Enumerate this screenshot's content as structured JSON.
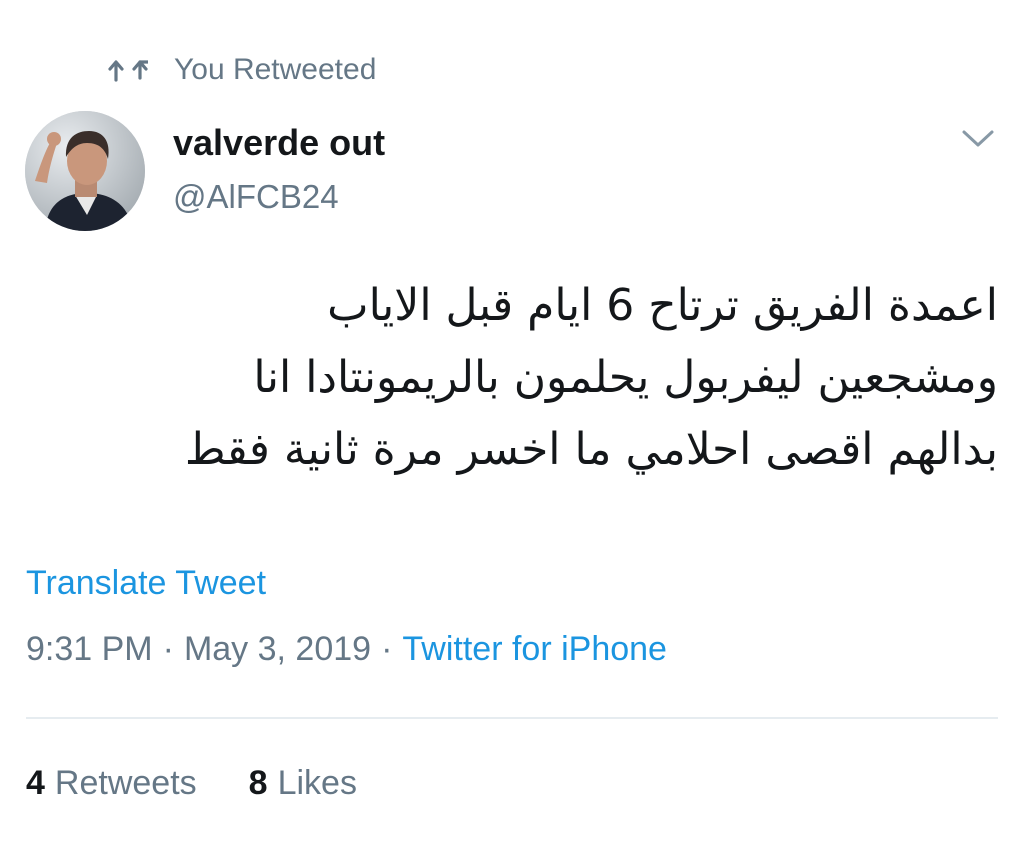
{
  "social_context": {
    "icon": "retweet-icon",
    "label": "You Retweeted"
  },
  "author": {
    "display_name": "valverde out",
    "handle": "@AlFCB24",
    "avatar": "avatar-photo"
  },
  "menu": {
    "icon": "chevron-down-icon"
  },
  "tweet": {
    "text_lines": [
      "اعمدة الفريق ترتاح 6 ايام قبل الاياب",
      "ومشجعين ليفربول يحلمون بالريمونتادا انا",
      "بدالهم اقصى احلامي ما اخسر مرة ثانية فقط"
    ],
    "translate_label": "Translate Tweet",
    "time": "9:31 PM",
    "separator": "·",
    "date": "May 3, 2019",
    "source": "Twitter for iPhone"
  },
  "stats": {
    "retweets_count": "4",
    "retweets_label": "Retweets",
    "likes_count": "8",
    "likes_label": "Likes"
  },
  "colors": {
    "link": "#1b95e0",
    "secondary_text": "#657786",
    "primary_text": "#14171a",
    "divider": "#e6ecf0"
  }
}
